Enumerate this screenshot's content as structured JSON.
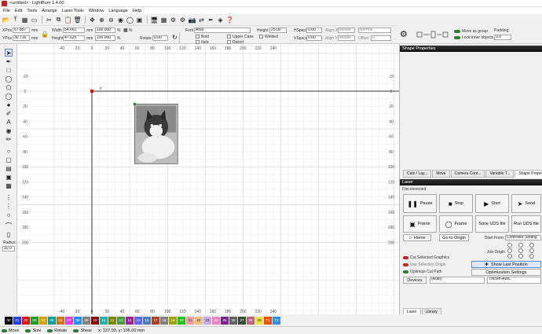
{
  "window": {
    "title": "<untitled> - LightBurn 1.4.00"
  },
  "menu": [
    "File",
    "Edit",
    "Tools",
    "Arrange",
    "Laser Tools",
    "Window",
    "Language",
    "Help"
  ],
  "props": {
    "xpos_label": "XPos",
    "xpos": "67.857",
    "ypos_label": "YPos",
    "ypos": "30.716",
    "width_label": "Width",
    "width": "54.661",
    "height_label": "Height",
    "height": "47.625",
    "unit": "mm",
    "pct_w": "100.000",
    "pct_h": "100.000",
    "pct": "%",
    "rotate_label": "Rotate",
    "rotate": "0.00",
    "font_label": "Font",
    "font": "Arial",
    "font_height_label": "Height",
    "font_height": "25.00",
    "bold": "Bold",
    "italic": "Italic",
    "upper": "Upper Case",
    "distort": "Distort",
    "welded": "Welded",
    "hspace_label": "HSpace",
    "hspace": "0.00",
    "vspace_label": "VSpace",
    "vspace": "0.00",
    "alignx_label": "Align X",
    "alignx": "Middle",
    "aligny_label": "Align Y",
    "aligny": "Middle",
    "mode": "Normal",
    "offset_label": "Offset",
    "offset": "0",
    "move_group": "Move as group",
    "lock_inner": "Lock inner objects",
    "padding_label": "Padding:",
    "padding": "0.0"
  },
  "left_tools": {
    "radius_label": "Radius:",
    "radius": "10.0"
  },
  "canvas": {
    "x_ticks": [
      "-40",
      "-20",
      "0",
      "20",
      "40",
      "60",
      "80",
      "100",
      "120",
      "140",
      "160",
      "180",
      "200",
      "220",
      "240"
    ],
    "y_ticks": [
      "-20",
      "0",
      "20",
      "40",
      "60",
      "80",
      "100",
      "120",
      "140",
      "160",
      "180",
      "200"
    ],
    "origin_label": "0"
  },
  "shape_panel": {
    "title": "Shape Properties"
  },
  "mid_tabs": [
    "Cuts / Lay...",
    "Move",
    "Camera Cont...",
    "Variable T...",
    "Shape Propert..."
  ],
  "laser": {
    "title": "Laser",
    "status": "Disconnected",
    "pause": "Pause",
    "stop": "Stop",
    "start": "Start",
    "send": "Send",
    "frame1": "Frame",
    "frame2": "Frame",
    "save_uds": "Save UDS file",
    "run_uds": "Run UDS file",
    "home": "Home",
    "go_origin": "Go to Origin",
    "start_from_label": "Start From:",
    "start_from": "Controller Setting",
    "job_origin_label": "Job Origin",
    "cut_selected": "Cut Selected Graphics",
    "use_selection_origin": "Use Selection Origin",
    "optimize_cut": "Optimize Cut Path",
    "show_last": "Show Last Position",
    "opt_settings": "Optimization Settings",
    "devices": "Devices",
    "device_port": "(Auto)",
    "device_name": "Trocen-AWC"
  },
  "bottom_tabs": [
    "Laser",
    "Library"
  ],
  "palette": {
    "labels": [
      "00",
      "01",
      "02",
      "03",
      "04",
      "05",
      "06",
      "07",
      "08",
      "09",
      "10",
      "11",
      "12",
      "13",
      "14",
      "15",
      "16",
      "17",
      "18",
      "19",
      "20",
      "21",
      "22",
      "23",
      "24",
      "25",
      "26",
      "27",
      "28",
      "29",
      "T1",
      "T2"
    ],
    "colors": [
      "#000000",
      "#1e3cff",
      "#e01010",
      "#20a020",
      "#d4a000",
      "#00a0a0",
      "#d47000",
      "#e040e0",
      "#1e90ff",
      "#808080",
      "#8b0000",
      "#20b2aa",
      "#808000",
      "#40a040",
      "#a020a0",
      "#6060ff",
      "#4682b4",
      "#b04020",
      "#808080",
      "#a0a000",
      "#20c020",
      "#f0a0a0",
      "#f0c080",
      "#c8a8f0",
      "#f080c0",
      "#7b2090",
      "#606060",
      "#305030",
      "#c06080",
      "#f0e040",
      "#f05000",
      "#3090f0"
    ]
  },
  "status": {
    "move": "Move",
    "size": "Size",
    "rotate": "Rotate",
    "shear": "Shear",
    "coords": "x: 137.00, y: 106.00 mm"
  }
}
